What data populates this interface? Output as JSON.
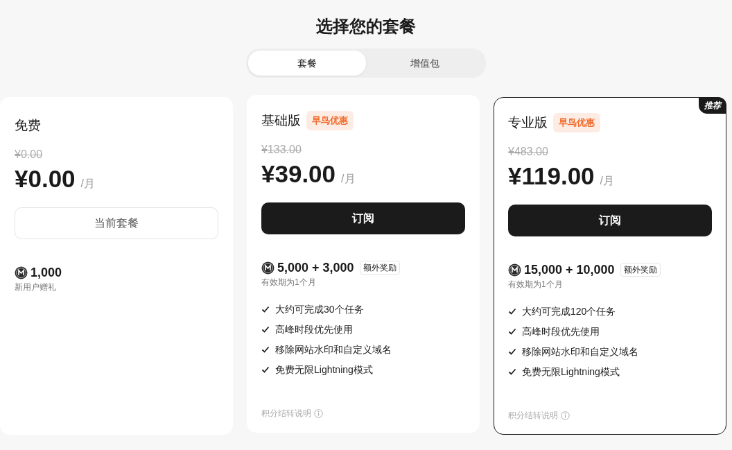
{
  "title": "选择您的套餐",
  "tabs": [
    {
      "label": "套餐",
      "selected": true
    },
    {
      "label": "增值包",
      "selected": false
    }
  ],
  "plans": [
    {
      "name": "免费",
      "highlighted": false,
      "original_price": "¥0.00",
      "price": "¥0.00",
      "period": "/月",
      "button": {
        "label": "当前套餐",
        "kind": "current"
      },
      "credits": "1,000",
      "credits_note": "新用户赠礼"
    },
    {
      "name": "基础版",
      "highlighted": false,
      "badge": "早鸟优惠",
      "original_price": "¥133.00",
      "price": "¥39.00",
      "period": "/月",
      "button": {
        "label": "订阅",
        "kind": "subscribe"
      },
      "credits": "5,000 + 3,000",
      "bonus": "额外奖励",
      "credits_note": "有效期为1个月",
      "features": [
        "大约可完成30个任务",
        "高峰时段优先使用",
        "移除网站水印和自定义域名",
        "免费无限Lightning模式"
      ],
      "footer": "积分结转说明"
    },
    {
      "name": "专业版",
      "badge": "早鸟优惠",
      "ribbon": "推荐",
      "highlighted": true,
      "original_price": "¥483.00",
      "price": "¥119.00",
      "period": "/月",
      "button": {
        "label": "订阅",
        "kind": "subscribe"
      },
      "credits": "15,000 + 10,000",
      "bonus": "额外奖励",
      "credits_note": "有效期为1个月",
      "features": [
        "大约可完成120个任务",
        "高峰时段优先使用",
        "移除网站水印和自定义域名",
        "免费无限Lightning模式"
      ],
      "footer": "积分结转说明"
    }
  ]
}
